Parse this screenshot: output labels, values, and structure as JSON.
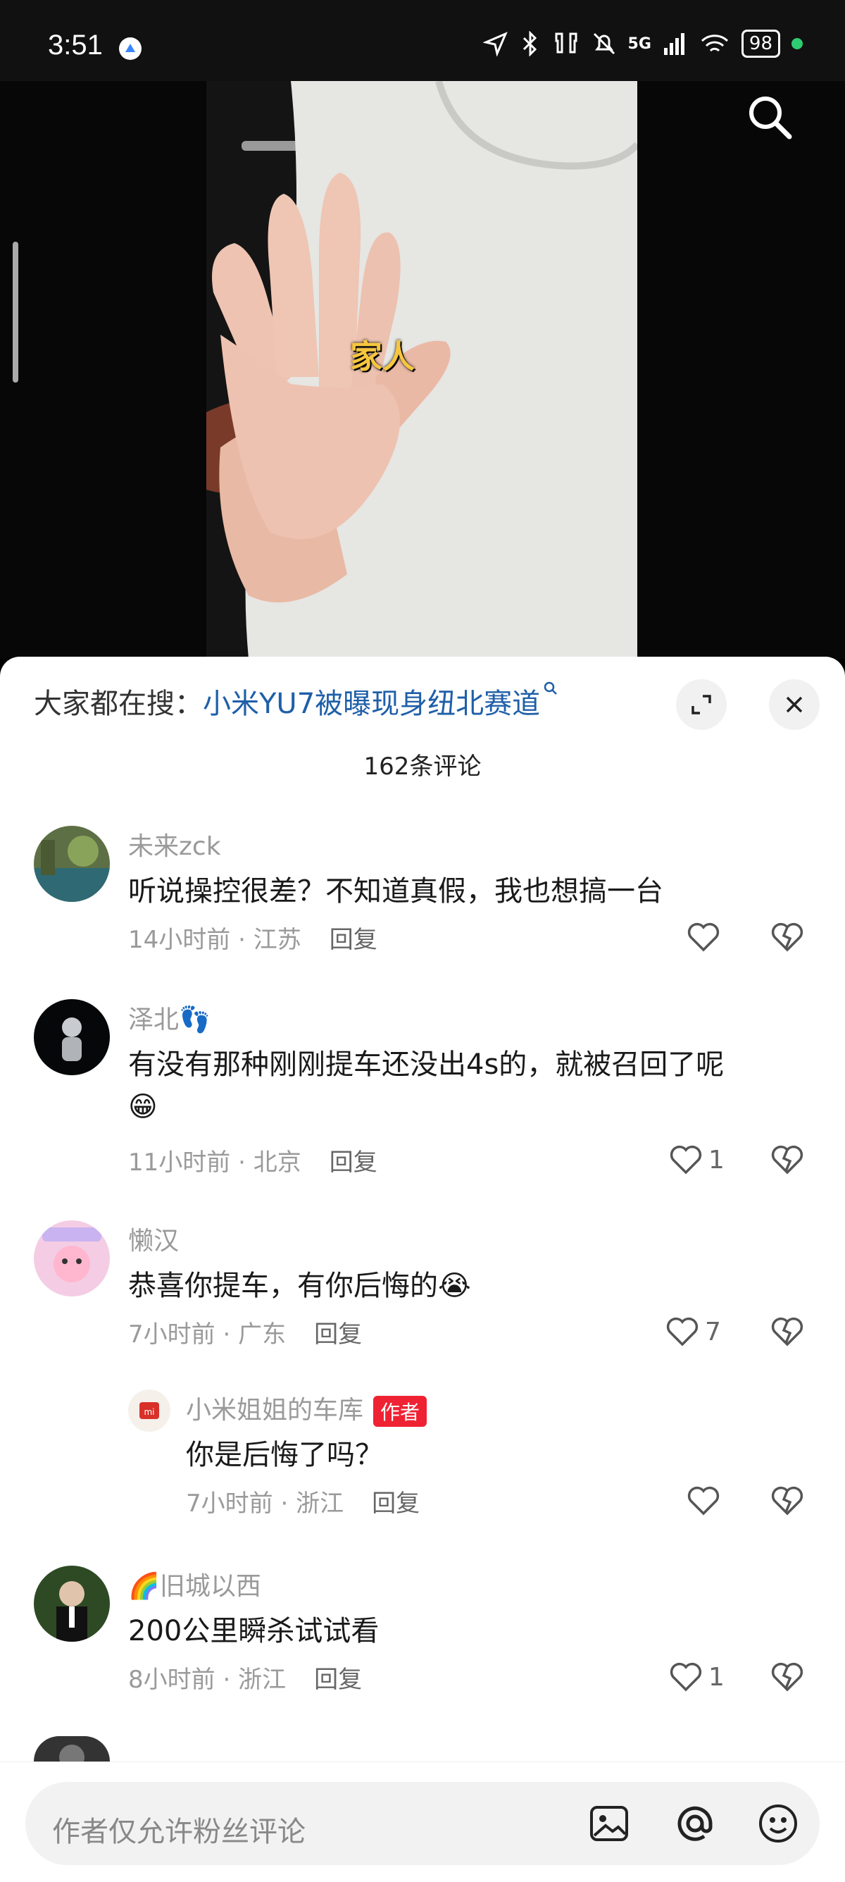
{
  "status": {
    "time": "3:51",
    "network": "5G",
    "battery": "98"
  },
  "video": {
    "caption": "家人"
  },
  "trending": {
    "prefix": "大家都在搜：",
    "query": "小米YU7被曝现身纽北赛道"
  },
  "comments_count": "162条评论",
  "comments": [
    {
      "name": "未来zck",
      "text": "听说操控很差？不知道真假，我也想搞一台",
      "time": "14小时前",
      "location": "江苏",
      "reply": "回复",
      "likes": ""
    },
    {
      "name": "泽北👣",
      "text": "有没有那种刚刚提车还没出4s的，就被召回了呢",
      "text2": "😁",
      "time": "11小时前",
      "location": "北京",
      "reply": "回复",
      "likes": "1"
    },
    {
      "name": "懒汉",
      "text": "恭喜你提车，有你后悔的😭",
      "time": "7小时前",
      "location": "广东",
      "reply": "回复",
      "likes": "7"
    },
    {
      "name": "小米姐姐的车库",
      "badge": "作者",
      "text": "你是后悔了吗？",
      "time": "7小时前",
      "location": "浙江",
      "reply": "回复",
      "likes": ""
    },
    {
      "name": "🌈旧城以西",
      "text": "200公里瞬杀试试看",
      "time": "8小时前",
      "location": "浙江",
      "reply": "回复",
      "likes": "1"
    }
  ],
  "input": {
    "placeholder": "作者仅允许粉丝评论"
  },
  "colors": {
    "link": "#1f5fa8",
    "badge": "#ee2233",
    "caption": "#f7c63e"
  }
}
